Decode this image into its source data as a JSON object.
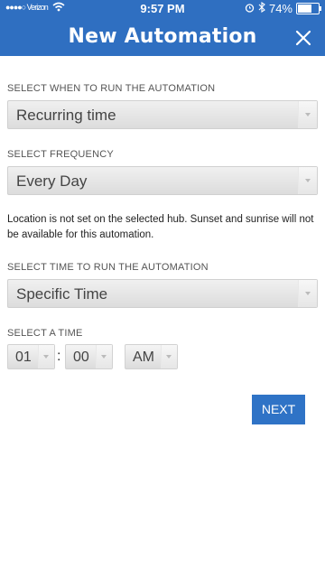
{
  "status_bar": {
    "carrier": "●●●●○ Verizon",
    "time": "9:57 PM",
    "battery": "74%",
    "battery_level": 0.74
  },
  "header": {
    "title": "New Automation",
    "close_icon": "close-icon",
    "color": "#2f6fc1"
  },
  "form": {
    "when_label": "SELECT WHEN TO RUN THE AUTOMATION",
    "when_value": "Recurring time",
    "frequency_label": "SELECT FREQUENCY",
    "frequency_value": "Every Day",
    "location_note": "Location is not set on the selected hub. Sunset and sunrise will not be available for this automation.",
    "time_mode_label": "SELECT TIME TO RUN THE AUTOMATION",
    "time_mode_value": "Specific Time",
    "time_label": "SELECT A TIME",
    "hour": "01",
    "separator": ":",
    "minute": "00",
    "ampm": "AM"
  },
  "actions": {
    "next_label": "NEXT"
  }
}
